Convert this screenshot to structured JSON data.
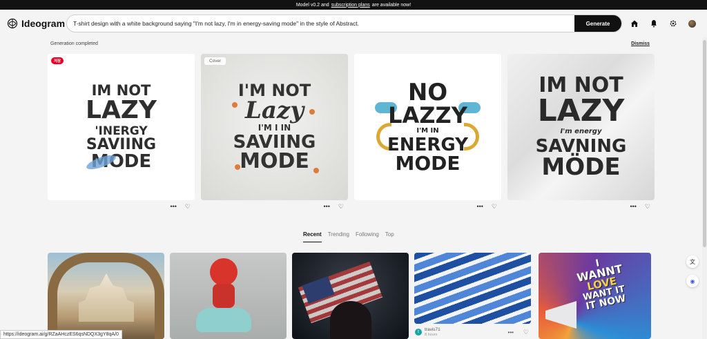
{
  "banner": {
    "text_before": "Model v0.2 and",
    "link": "subscription plans",
    "text_after": "are available now!"
  },
  "header": {
    "logo": "Ideogram",
    "prompt_value": "T-shirt design with a white background saying \"I'm not lazy, I'm in energy-saving mode\" in the style of Abstract.",
    "generate_label": "Generate"
  },
  "status": {
    "message": "Generation completed",
    "dismiss": "Dismiss"
  },
  "generations": [
    {
      "badge": "저장",
      "lines": [
        "IM NOT",
        "LAZY",
        "'INERGY",
        "SAVIING",
        "MODE"
      ]
    },
    {
      "badge": "Cover",
      "lines": [
        "I'M NOT",
        "Lazy",
        "I'M I IN",
        "SAVIING",
        "MODE"
      ]
    },
    {
      "badge": "",
      "lines": [
        "NO",
        "LAZZY",
        "I'M IN",
        "ENERGY",
        "MODE"
      ]
    },
    {
      "badge": "",
      "lines": [
        "IM NOT",
        "LAZY",
        "I'm energy",
        "SAVNING",
        "MÖDE"
      ]
    }
  ],
  "tabs": [
    "Recent",
    "Trending",
    "Following",
    "Top"
  ],
  "feed": {
    "meta_user": "travis71",
    "meta_avatar_initial": "t",
    "meta_time": "8 hours",
    "last_item_text": [
      "I",
      "WANNT",
      "LOVE",
      "WANT IT",
      "IT NOW"
    ]
  },
  "status_url": "https://ideogram.ai/g/RZaAHczES6qsNDQX3gY8qA/0",
  "icons": {
    "more": "more-icon",
    "like": "heart-icon",
    "home": "home-icon",
    "bell": "bell-icon",
    "settings": "gear-icon"
  }
}
